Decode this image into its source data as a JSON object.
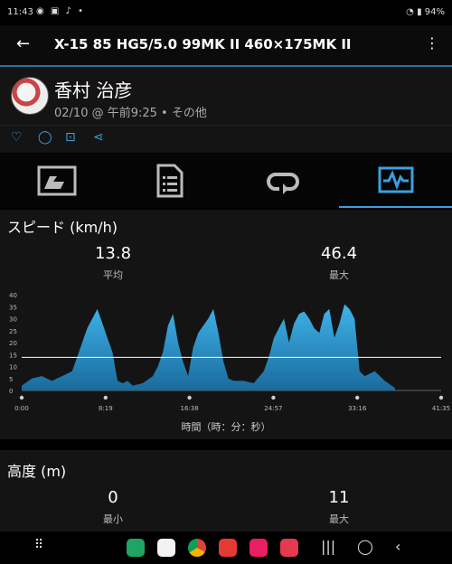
{
  "status_bar": {
    "time": "11:43",
    "battery": "94%"
  },
  "app_bar": {
    "title": "X-15 85 HG5/5.0 99MK II 460×175MK II"
  },
  "activity": {
    "user": "香村 治彦",
    "meta": "02/10 @ 午前9:25 • その他"
  },
  "speed": {
    "title": "スピード (km/h)",
    "avg_value": "13.8",
    "avg_label": "平均",
    "max_value": "46.4",
    "max_label": "最大"
  },
  "chart_data": {
    "type": "area",
    "ylabel": "",
    "xlabel": "時間（時：分：秒）",
    "ylim": [
      0,
      40
    ],
    "yticks": [
      "40",
      "35",
      "30",
      "25",
      "20",
      "15",
      "10",
      "5",
      "0"
    ],
    "xticks": [
      "0:00",
      "8:19",
      "16:38",
      "24:57",
      "33:16",
      "41:35"
    ],
    "reference_line": 13.8,
    "x_minutes": [
      0,
      1,
      2,
      3,
      4,
      5,
      5.5,
      6,
      6.5,
      7,
      7.5,
      8,
      8.5,
      9,
      9.5,
      10,
      10.5,
      11,
      12,
      13,
      13.5,
      14,
      14.5,
      15,
      15.5,
      16,
      16.5,
      17,
      17.5,
      18,
      18.5,
      19,
      19.5,
      20,
      20.5,
      21,
      22,
      23,
      24,
      24.5,
      25,
      25.5,
      26,
      26.5,
      27,
      27.5,
      28,
      28.5,
      29,
      29.5,
      30,
      30.5,
      31,
      31.5,
      32,
      32.5,
      33,
      33.5,
      34,
      35,
      36,
      37
    ],
    "y_kmh": [
      2,
      5,
      6,
      4,
      6,
      8,
      14,
      20,
      26,
      30,
      34,
      28,
      22,
      16,
      4,
      3,
      4,
      2,
      3,
      6,
      10,
      16,
      27,
      32,
      20,
      12,
      6,
      18,
      24,
      27,
      30,
      34,
      24,
      12,
      5,
      4,
      4,
      3,
      8,
      14,
      22,
      26,
      30,
      20,
      28,
      32,
      33,
      30,
      26,
      24,
      32,
      34,
      22,
      28,
      36,
      34,
      30,
      8,
      6,
      8,
      4,
      1
    ]
  },
  "elevation": {
    "title": "高度 (m)",
    "min_value": "0",
    "min_label": "最小",
    "max_value": "11",
    "max_label": "最大"
  }
}
